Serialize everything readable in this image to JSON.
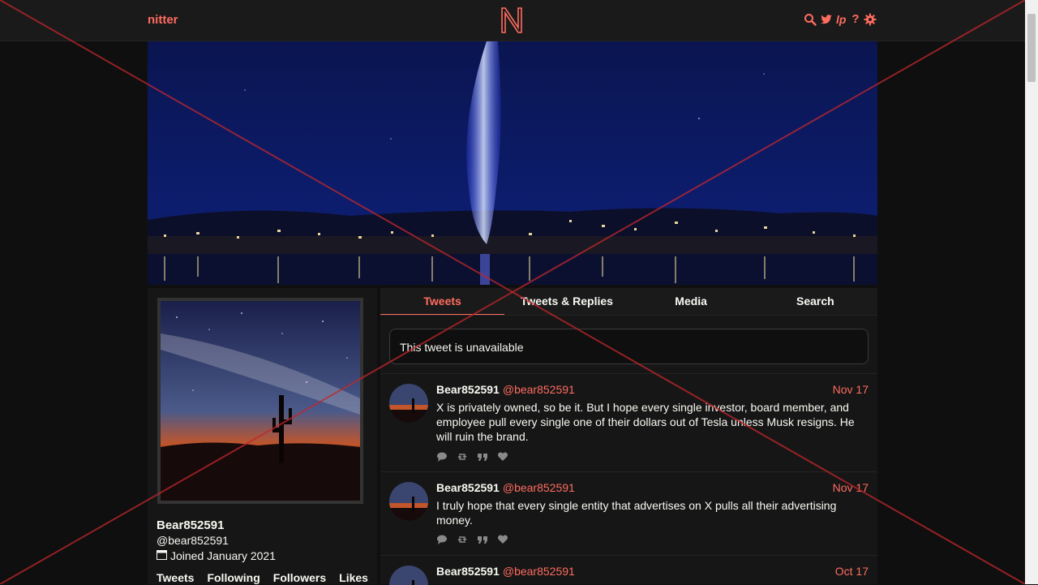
{
  "nav": {
    "brand": "nitter",
    "icons": [
      "search-icon",
      "twitter-bird-icon",
      "rss-icon",
      "help-icon",
      "gear-icon"
    ],
    "help_label": "?",
    "rss_label": "lp"
  },
  "profile": {
    "fullname": "Bear852591",
    "username": "@bear852591",
    "joined": "Joined January 2021",
    "stats": [
      "Tweets",
      "Following",
      "Followers",
      "Likes"
    ]
  },
  "tabs": [
    "Tweets",
    "Tweets & Replies",
    "Media",
    "Search"
  ],
  "active_tab": "Tweets",
  "unavailable_text": "This tweet is unavailable",
  "tweets": [
    {
      "fullname": "Bear852591",
      "username": "@bear852591",
      "date": "Nov 17",
      "text": "X is privately owned, so be it. But I hope every single investor, board member, and employee pull every single one of their dollars out of Tesla unless Musk resigns. He will ruin the brand."
    },
    {
      "fullname": "Bear852591",
      "username": "@bear852591",
      "date": "Nov 17",
      "text": "I truly hope that every single entity that advertises on X pulls all their advertising money."
    },
    {
      "fullname": "Bear852591",
      "username": "@bear852591",
      "date": "Oct 17",
      "text": ""
    }
  ],
  "colors": {
    "accent": "#ff6c60",
    "background": "#0f0f0f",
    "panel": "#161616",
    "text": "#f8f8f2",
    "overlay_cross": "#c0272d"
  }
}
